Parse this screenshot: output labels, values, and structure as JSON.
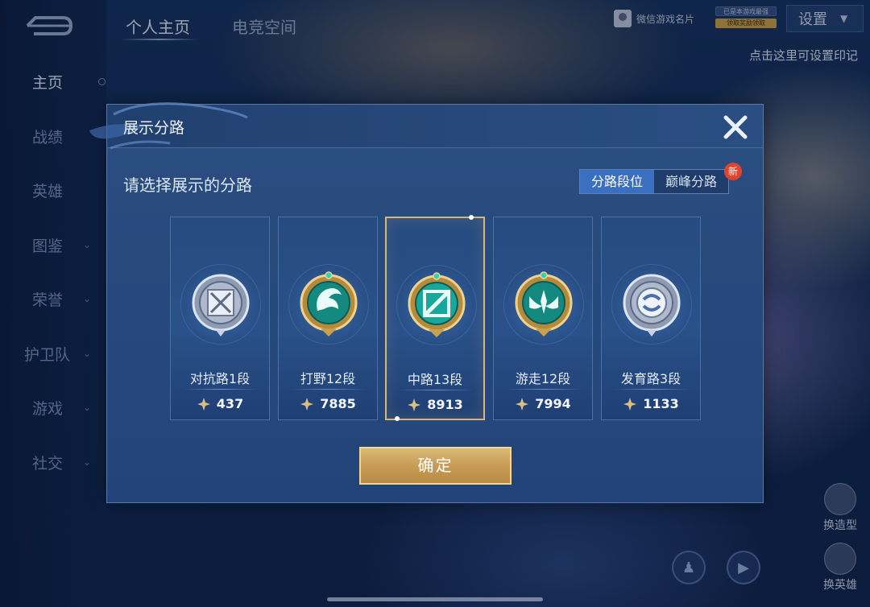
{
  "sidebar": {
    "items": [
      {
        "label": "主页",
        "has_chevron": false,
        "active": true
      },
      {
        "label": "战绩",
        "has_chevron": false,
        "active": false
      },
      {
        "label": "英雄",
        "has_chevron": false,
        "active": false
      },
      {
        "label": "图鉴",
        "has_chevron": true,
        "active": false
      },
      {
        "label": "荣誉",
        "has_chevron": true,
        "active": false
      },
      {
        "label": "护卫队",
        "has_chevron": true,
        "active": false
      },
      {
        "label": "游戏",
        "has_chevron": true,
        "active": false
      },
      {
        "label": "社交",
        "has_chevron": true,
        "active": false
      }
    ]
  },
  "header": {
    "tabs": [
      {
        "label": "个人主页",
        "active": true
      },
      {
        "label": "电竞空间",
        "active": false
      }
    ],
    "wechat_card_label": "微信游戏名片",
    "badge_top": "已是本游戏最强",
    "badge_bottom": "领取奖励领取",
    "settings_label": "设置",
    "hint": "点击这里可设置印记"
  },
  "right_actions": {
    "action1_label": "换造型",
    "action2_label": "换英雄"
  },
  "modal": {
    "title": "展示分路",
    "subtitle": "请选择展示的分路",
    "toggle": {
      "options": [
        "分路段位",
        "巅峰分路"
      ],
      "selected_index": 0,
      "new_badge": "新"
    },
    "lanes": [
      {
        "name": "对抗路1段",
        "score": "437",
        "icon": "clash-lane-silver-emblem",
        "selected": false
      },
      {
        "name": "打野12段",
        "score": "7885",
        "icon": "jungle-gold-emblem",
        "selected": false
      },
      {
        "name": "中路13段",
        "score": "8913",
        "icon": "mid-lane-gold-emblem",
        "selected": true
      },
      {
        "name": "游走12段",
        "score": "7994",
        "icon": "roam-gold-emblem",
        "selected": false
      },
      {
        "name": "发育路3段",
        "score": "1133",
        "icon": "farm-lane-silver-emblem",
        "selected": false
      }
    ],
    "confirm_label": "确定"
  },
  "colors": {
    "selected_border": "#d7b478",
    "confirm_gold": "#c79c55",
    "toggle_active": "#3b6fc0",
    "badge_red": "#e0442e",
    "emblem_teal": "#18a79a",
    "emblem_gold": "#caa24e",
    "emblem_silver": "#b9c6da"
  }
}
